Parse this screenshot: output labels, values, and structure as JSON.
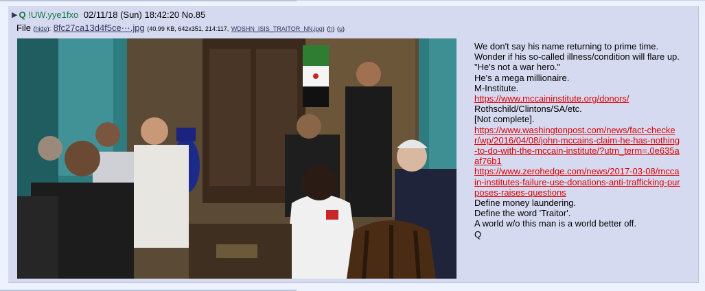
{
  "post": {
    "arrow": "▶",
    "name": "Q",
    "tripcode": "!UW.yye1fxo",
    "datetime": "02/11/18 (Sun) 18:42:20",
    "post_number": "No.85"
  },
  "file": {
    "label": "File",
    "hide_label": "hide",
    "filename": "8fc27ca13d4f5ce···.jpg",
    "meta": "(40.99 KB, 642x351, 214:117,",
    "original_name": "WDSHN_ISIS_TRAITOR_NN.jpg",
    "h_link": "h",
    "u_link": "u"
  },
  "message": {
    "lines": [
      "We don't say his name returning to prime time.",
      "Wonder if his so-called illness/condition will flare up.",
      "\"He's not a war hero.\"",
      "He's a mega millionaire.",
      "M-Institute."
    ],
    "link1": "https://www.mccaininstitute.org/donors/",
    "lines2": [
      "Rothschild/Clintons/SA/etc.",
      "[Not complete]."
    ],
    "link2": "https://www.washingtonpost.com/news/fact-checker/wp/2016/04/08/john-mccains-claim-he-has-nothing-to-do-with-the-mccain-institute/?utm_term=.0e635aaf76b1",
    "link3": "https://www.zerohedge.com/news/2017-03-08/mccain-institutes-failure-use-donations-anti-trafficking-purposes-raises-questions",
    "lines3": [
      "Define money laundering.",
      "Define the word 'Traitor'.",
      "A world w/o this man is a world better off.",
      "Q"
    ]
  },
  "colors": {
    "page_bg": "#eef2ff",
    "post_bg": "#d6daf0",
    "name": "#117743",
    "link": "#34345c",
    "url": "#dd0000"
  }
}
